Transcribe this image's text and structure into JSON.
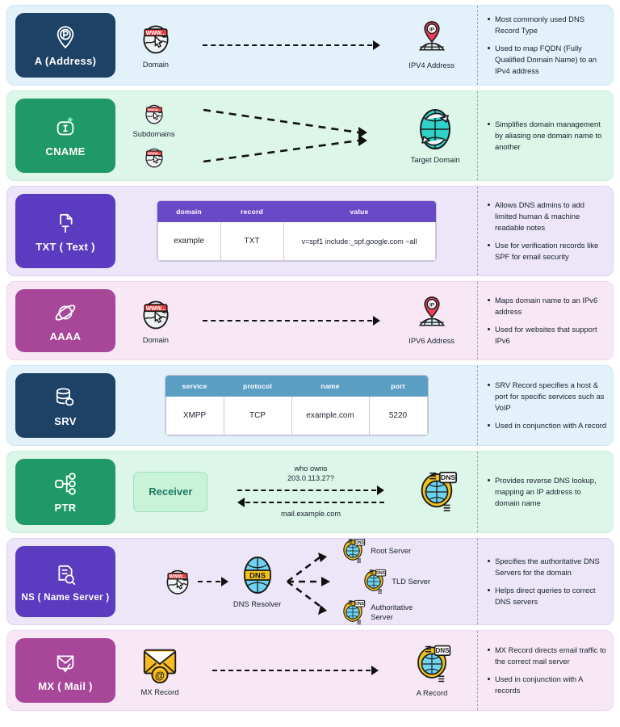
{
  "rows": [
    {
      "key": "a",
      "badge": {
        "label": "A (Address)",
        "icon": "location-pin-icon"
      },
      "nodes": {
        "source": "Domain",
        "target": "IPV4 Address"
      },
      "notes": [
        "Most commonly used DNS Record Type",
        "Used to map FQDN (Fully Qualified Domain Name) to an IPv4 address"
      ]
    },
    {
      "key": "cname",
      "badge": {
        "label": "CNAME",
        "icon": "id-card-icon"
      },
      "nodes": {
        "source": "Subdomains",
        "target": "Target Domain"
      },
      "notes": [
        "Simplifies domain management by aliasing one domain name to another"
      ]
    },
    {
      "key": "txt",
      "badge": {
        "label": "TXT ( Text )",
        "icon": "document-text-icon"
      },
      "table": {
        "headers": [
          "domain",
          "record",
          "value"
        ],
        "rows": [
          [
            "example",
            "TXT",
            "v=spf1 include:_spf.google.com ~all"
          ]
        ]
      },
      "notes": [
        "Allows DNS admins to add limited human & machine readable notes",
        "Use for verification records like SPF for email security"
      ]
    },
    {
      "key": "aaaa",
      "badge": {
        "label": "AAAA",
        "icon": "planet-icon"
      },
      "nodes": {
        "source": "Domain",
        "target": "IPV6 Address"
      },
      "notes": [
        "Maps domain name to an IPv6 address",
        "Used for websites that support IPv6"
      ]
    },
    {
      "key": "srv",
      "badge": {
        "label": "SRV",
        "icon": "database-icon"
      },
      "table": {
        "headers": [
          "service",
          "protocol",
          "name",
          "port"
        ],
        "rows": [
          [
            "XMPP",
            "TCP",
            "example.com",
            "5220"
          ]
        ]
      },
      "notes": [
        "SRV Record specifies a host & port for specific services such as VoIP",
        "Used in conjunction with A record"
      ]
    },
    {
      "key": "ptr",
      "badge": {
        "label": "PTR",
        "icon": "node-tree-icon"
      },
      "nodes": {
        "source": "Receiver",
        "target": "dns-server-icon"
      },
      "query_label": "who owns\n203.0.113.27?",
      "response_label": "mail.example.com",
      "notes": [
        "Provides reverse DNS lookup, mapping an IP address to domain name"
      ]
    },
    {
      "key": "ns",
      "badge": {
        "label": "NS ( Name Server )",
        "icon": "document-search-icon"
      },
      "nodes": {
        "source": "",
        "resolver": "DNS Resolver",
        "branch1": "Root Server",
        "branch2": "TLD Server",
        "branch3": "Authoritative\nServer"
      },
      "notes": [
        "Specifies the authoritative DNS Servers for the domain",
        "Helps direct queries to correct DNS servers"
      ]
    },
    {
      "key": "mx",
      "badge": {
        "label": "MX ( Mail )",
        "icon": "mail-check-icon"
      },
      "nodes": {
        "source": "MX Record",
        "target": "A Record"
      },
      "notes": [
        "MX Record directs email traffic to the correct mail server",
        "Used in conjunction with A records"
      ]
    }
  ],
  "colors": {
    "navy": "#1d4265",
    "green": "#209968",
    "purple": "#5b3bbf",
    "mauve": "#a8479a",
    "tint_blue": "#e3f1fa",
    "tint_green": "#ddf6ea",
    "tint_purple": "#ece6f8",
    "tint_pink": "#f8e8f6",
    "table_header_purple": "#6a49c9",
    "table_header_blue": "#5b9ec4"
  }
}
